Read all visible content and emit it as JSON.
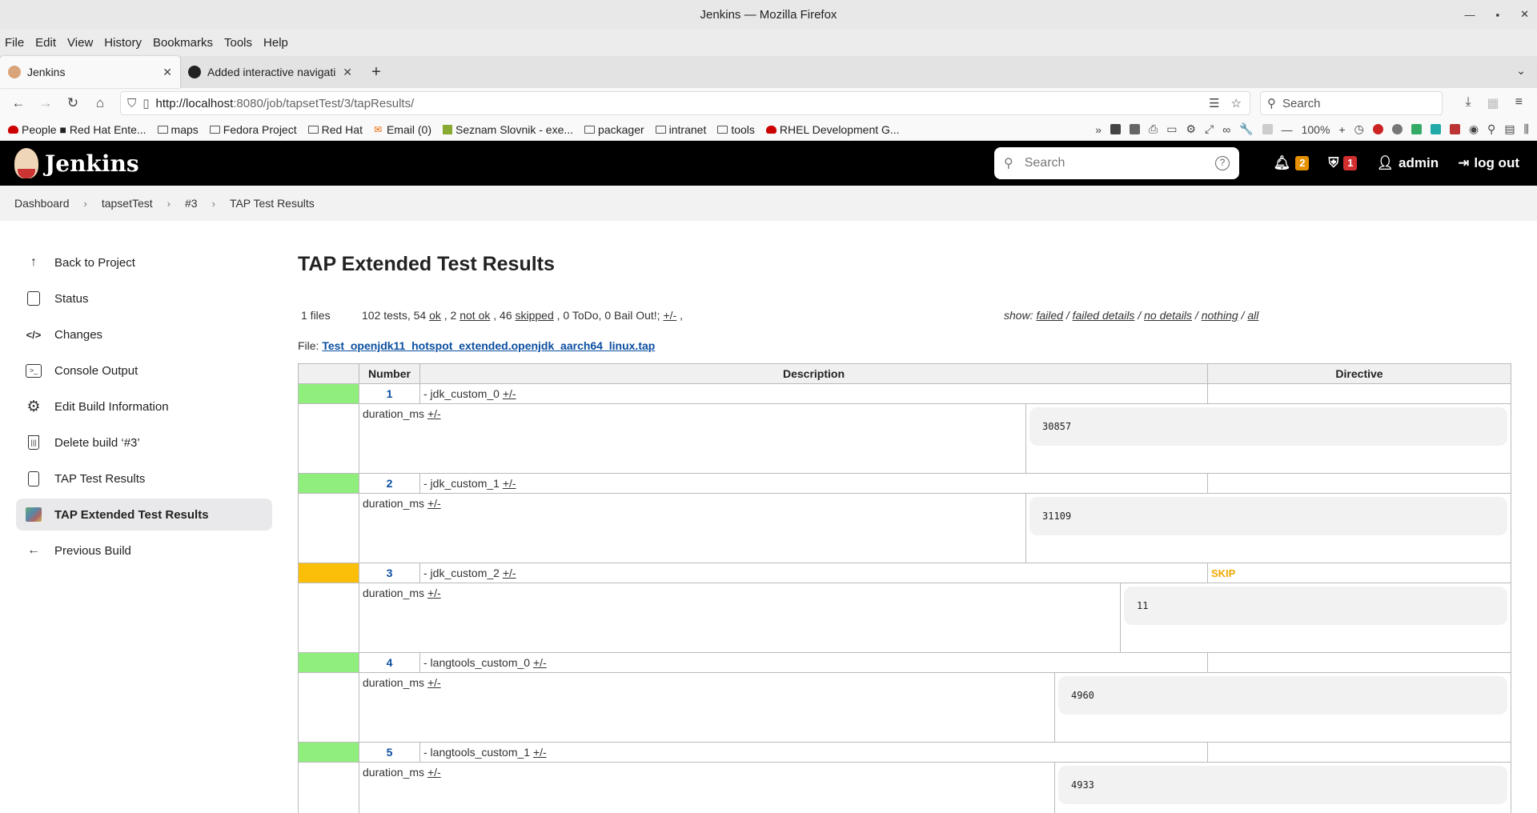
{
  "window": {
    "title": "Jenkins — Mozilla Firefox"
  },
  "menu": [
    "File",
    "Edit",
    "View",
    "History",
    "Bookmarks",
    "Tools",
    "Help"
  ],
  "tabs": [
    {
      "title": "Jenkins",
      "active": true
    },
    {
      "title": "Added interactive navigati",
      "active": false
    }
  ],
  "url": {
    "host": "http://localhost",
    "path": ":8080/job/tapsetTest/3/tapResults/"
  },
  "browser_search": {
    "placeholder": "Search"
  },
  "bookmarks": [
    "People ■ Red Hat Ente...",
    "maps",
    "Fedora Project",
    "Red Hat",
    "Email (0)",
    "Seznam Slovnik - exe...",
    "packager",
    "intranet",
    "tools",
    "RHEL Development G..."
  ],
  "zoom": "100%",
  "jenkins": {
    "brand": "Jenkins",
    "search_placeholder": "Search",
    "notifications": "2",
    "warnings": "1",
    "user": "admin",
    "logout": "log out"
  },
  "breadcrumb": [
    "Dashboard",
    "tapsetTest",
    "#3",
    "TAP Test Results"
  ],
  "sidebar": [
    {
      "label": "Back to Project",
      "icon": "arrow-up-icon"
    },
    {
      "label": "Status",
      "icon": "document-icon"
    },
    {
      "label": "Changes",
      "icon": "code-icon"
    },
    {
      "label": "Console Output",
      "icon": "terminal-icon"
    },
    {
      "label": "Edit Build Information",
      "icon": "gear-icon"
    },
    {
      "label": "Delete build ‘#3’",
      "icon": "trash-icon"
    },
    {
      "label": "TAP Test Results",
      "icon": "clipboard-icon"
    },
    {
      "label": "TAP Extended Test Results",
      "icon": "tap-image-icon",
      "active": true
    },
    {
      "label": "Previous Build",
      "icon": "arrow-left-icon"
    }
  ],
  "page": {
    "title": "TAP Extended Test Results",
    "files": "1 files",
    "counts_prefix": "102 tests, 54 ",
    "ok": "ok",
    "comma1": " , 2 ",
    "not_ok": "not ok",
    "comma2": " , 46 ",
    "skipped": "skipped",
    "counts_suffix": " , 0 ToDo, 0 Bail Out!; ",
    "toggle": "+/-",
    "tail": " ,",
    "show_label": "show: ",
    "show_options": [
      "failed",
      "failed details",
      "no details",
      "nothing",
      "all"
    ],
    "file_label": "File: ",
    "file_name": "Test_openjdk11_hotspot_extended.openjdk_aarch64_linux.tap"
  },
  "table": {
    "headers": [
      "Number",
      "Description",
      "Directive"
    ],
    "diag_key": "duration_ms",
    "toggle": "+/-",
    "rows": [
      {
        "number": "1",
        "description": "- jdk_custom_0",
        "status": "ok",
        "directive": "",
        "duration": "30857"
      },
      {
        "number": "2",
        "description": "- jdk_custom_1",
        "status": "ok",
        "directive": "",
        "duration": "31109"
      },
      {
        "number": "3",
        "description": "- jdk_custom_2",
        "status": "skip",
        "directive": "SKIP",
        "duration": "11"
      },
      {
        "number": "4",
        "description": "- langtools_custom_0",
        "status": "ok",
        "directive": "",
        "duration": "4960"
      },
      {
        "number": "5",
        "description": "- langtools_custom_1",
        "status": "ok",
        "directive": "",
        "duration": "4933"
      }
    ]
  },
  "colors": {
    "ok": "#90ee7c",
    "skip": "#fbbf0a",
    "link": "#0b4fa0",
    "header": "#000000"
  }
}
